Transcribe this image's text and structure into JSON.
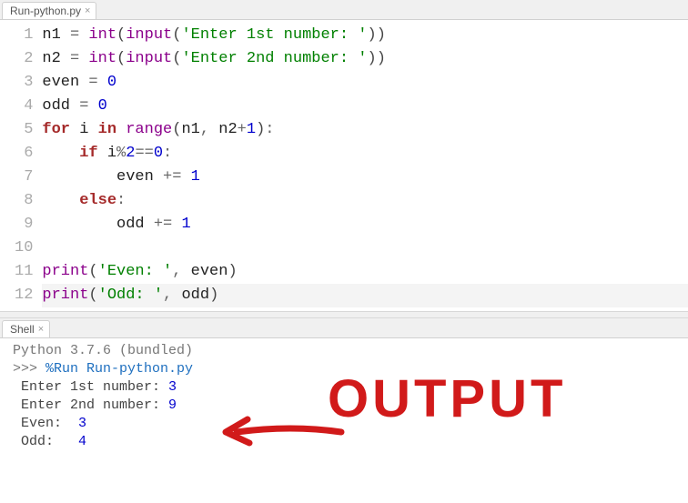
{
  "editor_tab": {
    "filename": "Run-python.py",
    "close_glyph": "×"
  },
  "code": {
    "lines": [
      {
        "n": "1",
        "tokens": [
          "n1",
          " = ",
          "int",
          "(",
          "input",
          "(",
          "'Enter 1st number: '",
          ")",
          ")"
        ],
        "cls": [
          "ident",
          "op",
          "builtin",
          "paren",
          "builtin",
          "paren",
          "str",
          "paren",
          "paren"
        ]
      },
      {
        "n": "2",
        "tokens": [
          "n2",
          " = ",
          "int",
          "(",
          "input",
          "(",
          "'Enter 2nd number: '",
          ")",
          ")"
        ],
        "cls": [
          "ident",
          "op",
          "builtin",
          "paren",
          "builtin",
          "paren",
          "str",
          "paren",
          "paren"
        ]
      },
      {
        "n": "3",
        "tokens": [
          "even",
          " = ",
          "0"
        ],
        "cls": [
          "ident",
          "op",
          "num"
        ]
      },
      {
        "n": "4",
        "tokens": [
          "odd",
          " = ",
          "0"
        ],
        "cls": [
          "ident",
          "op",
          "num"
        ]
      },
      {
        "n": "5",
        "tokens": [
          "for",
          " i ",
          "in",
          " ",
          "range",
          "(",
          "n1",
          ", ",
          "n2",
          "+",
          "1",
          ")",
          ":"
        ],
        "cls": [
          "kw",
          "ident",
          "kw",
          "",
          "builtin",
          "paren",
          "ident",
          "op",
          "ident",
          "op",
          "num",
          "paren",
          "op"
        ]
      },
      {
        "n": "6",
        "tokens": [
          "    ",
          "if",
          " i",
          "%",
          "2",
          "==",
          "0",
          ":"
        ],
        "cls": [
          "",
          "kw",
          "ident",
          "op",
          "num",
          "op",
          "num",
          "op"
        ]
      },
      {
        "n": "7",
        "tokens": [
          "        ",
          "even",
          " += ",
          "1"
        ],
        "cls": [
          "",
          "ident",
          "op",
          "num"
        ]
      },
      {
        "n": "8",
        "tokens": [
          "    ",
          "else",
          ":"
        ],
        "cls": [
          "",
          "kw",
          "op"
        ]
      },
      {
        "n": "9",
        "tokens": [
          "        ",
          "odd",
          " += ",
          "1"
        ],
        "cls": [
          "",
          "ident",
          "op",
          "num"
        ]
      },
      {
        "n": "10",
        "tokens": [
          ""
        ],
        "cls": [
          ""
        ]
      },
      {
        "n": "11",
        "tokens": [
          "print",
          "(",
          "'Even: '",
          ", ",
          "even",
          ")"
        ],
        "cls": [
          "builtin",
          "paren",
          "str",
          "op",
          "ident",
          "paren"
        ]
      },
      {
        "n": "12",
        "tokens": [
          "print",
          "(",
          "'Odd: '",
          ", ",
          "odd",
          ")"
        ],
        "cls": [
          "builtin",
          "paren",
          "str",
          "op",
          "ident",
          "paren"
        ],
        "hl": true
      }
    ]
  },
  "shell_tab": {
    "title": "Shell",
    "close_glyph": "×"
  },
  "shell": {
    "version_line": "Python 3.7.6 (bundled)",
    "prompt": ">>> ",
    "run_cmd": "%Run Run-python.py",
    "outputs": [
      {
        "label": "Enter 1st number: ",
        "value": "3"
      },
      {
        "label": "Enter 2nd number: ",
        "value": "9"
      },
      {
        "label": "Even:  ",
        "value": "3"
      },
      {
        "label": "Odd:   ",
        "value": "4"
      }
    ]
  },
  "annotation": {
    "text": "OUTPUT"
  }
}
